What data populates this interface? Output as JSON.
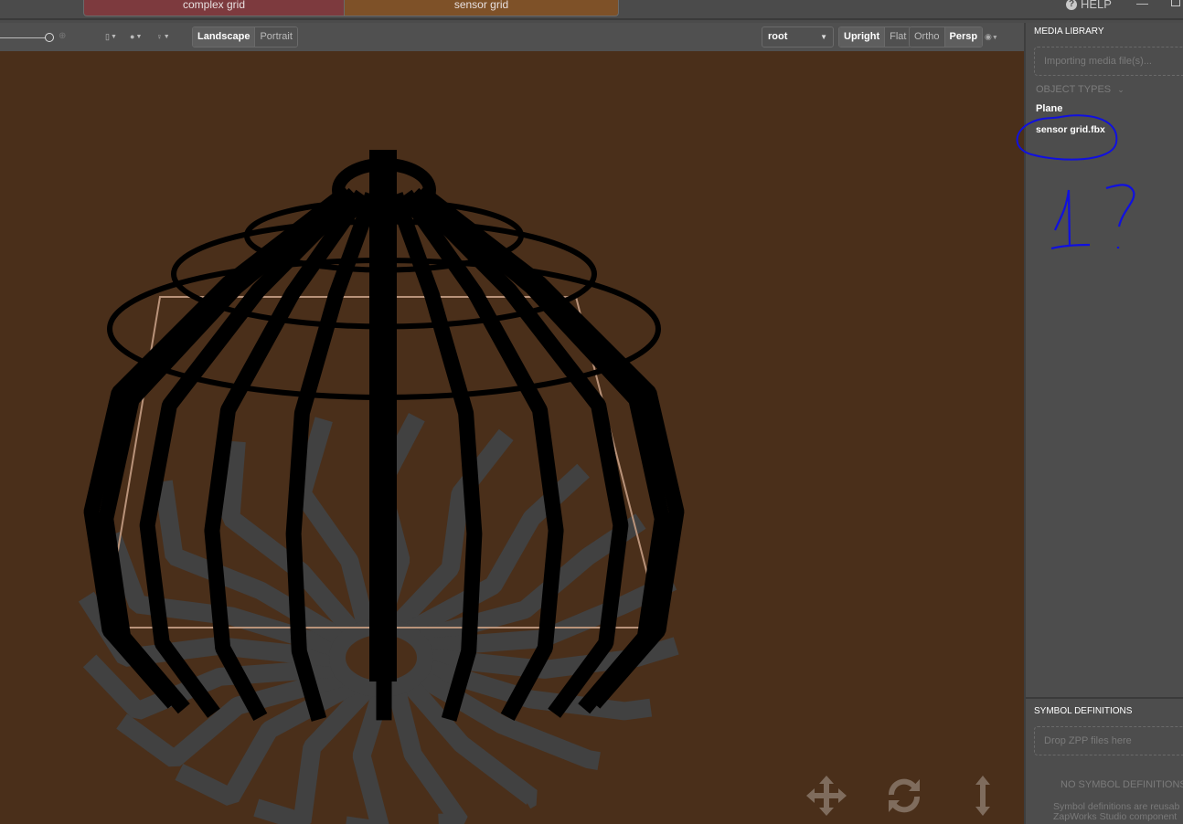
{
  "tabs": [
    {
      "label": "complex grid",
      "color": "#7d3a3e"
    },
    {
      "label": "sensor grid",
      "color": "#7e5128",
      "active": true
    }
  ],
  "window": {
    "help_label": "HELP",
    "help_icon": "question-circle-icon",
    "minimize_icon": "minimize-icon",
    "maximize_icon": "maximize-icon"
  },
  "toolbar": {
    "zoom_icon": "zoom-in-icon",
    "device_dropdown_icon": "phone-icon",
    "environment_dropdown_icon": "globe-icon",
    "light_dropdown_icon": "lightbulb-icon",
    "orientation": {
      "options": [
        "Landscape",
        "Portrait"
      ],
      "selected": "Landscape"
    },
    "root_select": {
      "value": "root"
    },
    "alignment": {
      "options": [
        "Upright",
        "Flat"
      ],
      "selected": "Upright"
    },
    "projection": {
      "options": [
        "Ortho",
        "Persp"
      ],
      "selected": "Persp"
    },
    "visibility_icon": "eye-icon"
  },
  "viewport": {
    "background": "#4a2f1a",
    "object": "sensor grid.fbx",
    "gizmos": [
      "move-icon",
      "rotate-icon",
      "scale-vertical-icon"
    ]
  },
  "media_library": {
    "title": "MEDIA LIBRARY",
    "dropzone_text": "Importing media file(s)...",
    "object_types_label": "OBJECT TYPES",
    "items": [
      "Plane",
      "sensor grid.fbx"
    ]
  },
  "annotation": {
    "text": "1?",
    "color": "#1010e0"
  },
  "symbol_definitions": {
    "title": "SYMBOL DEFINITIONS",
    "dropzone_text": "Drop ZPP files here",
    "empty_title": "NO SYMBOL DEFINITIONS",
    "description_line1": "Symbol definitions are reusab",
    "description_line2": "ZapWorks Studio component"
  }
}
